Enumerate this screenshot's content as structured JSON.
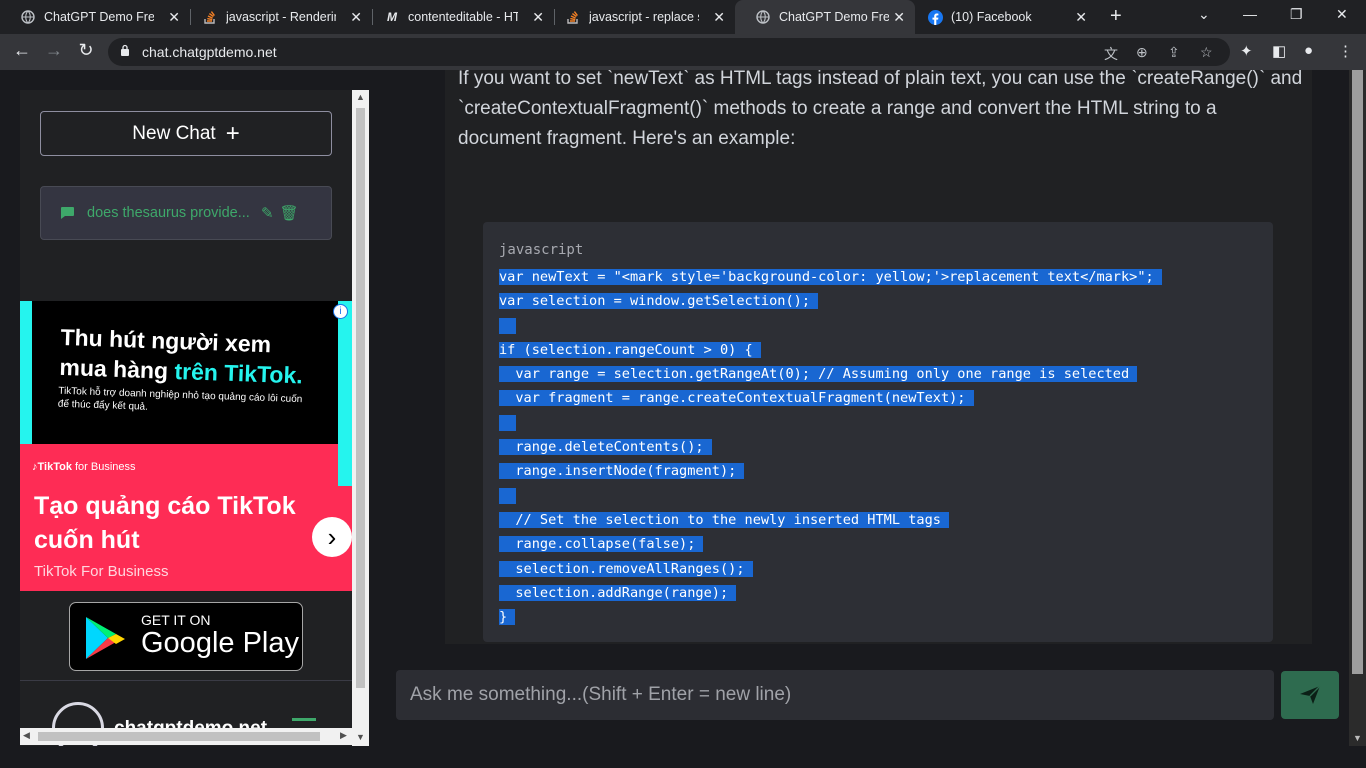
{
  "browser": {
    "tabs": [
      {
        "title": "ChatGPT Demo Free",
        "icon": "globe-icon"
      },
      {
        "title": "javascript - Rendering",
        "icon": "stackoverflow-icon"
      },
      {
        "title": "contenteditable - HTM",
        "icon": "mdn-icon"
      },
      {
        "title": "javascript - replace str",
        "icon": "stackoverflow-icon"
      },
      {
        "title": "ChatGPT Demo Free",
        "icon": "globe-icon"
      },
      {
        "title": "(10) Facebook",
        "icon": "facebook-icon"
      }
    ],
    "active_tab_index": 4,
    "url": "chat.chatgptdemo.net"
  },
  "sidebar": {
    "new_chat_label": "New Chat",
    "conversations": [
      {
        "title": "does thesaurus provide..."
      }
    ],
    "ad": {
      "headline_1": "Thu hút người xem",
      "headline_2a": "mua hàng ",
      "headline_2b": "trên TikTok.",
      "subtext": "TikTok hỗ trợ doanh nghiệp nhỏ tạo quảng cáo lôi cuốn để thúc đẩy kết quả.",
      "brand_a": "TikTok",
      "brand_b": " for Business",
      "big_text": "Tạo quảng cáo TikTok cuốn hút",
      "small_text": "TikTok For Business"
    },
    "store_badge": {
      "line1": "GET IT ON",
      "line2": "Google Play"
    },
    "footer_text": "chatgptdemo.net"
  },
  "message": {
    "text": "If you want to set `newText` as HTML tags instead of plain text, you can use the `createRange()` and `createContextualFragment()` methods to create a range and convert the HTML string to a document fragment. Here's an example:",
    "code_language": "javascript",
    "code_lines": [
      "var newText = \"<mark style='background-color: yellow;'>replacement text</mark>\";",
      "var selection = window.getSelection();",
      "",
      "if (selection.rangeCount > 0) {",
      "  var range = selection.getRangeAt(0); // Assuming only one range is selected",
      "  var fragment = range.createContextualFragment(newText);",
      "",
      "  range.deleteContents();",
      "  range.insertNode(fragment);",
      "",
      "  // Set the selection to the newly inserted HTML tags",
      "  range.collapse(false);",
      "  selection.removeAllRanges();",
      "  selection.addRange(range);",
      "}"
    ]
  },
  "input": {
    "placeholder": "Ask me something...(Shift + Enter = new line)"
  },
  "colors": {
    "accent_green": "#3ea86a",
    "selection_blue": "#1967d2",
    "tiktok_pink": "#fe2c55",
    "tiktok_cyan": "#25f4ee"
  }
}
